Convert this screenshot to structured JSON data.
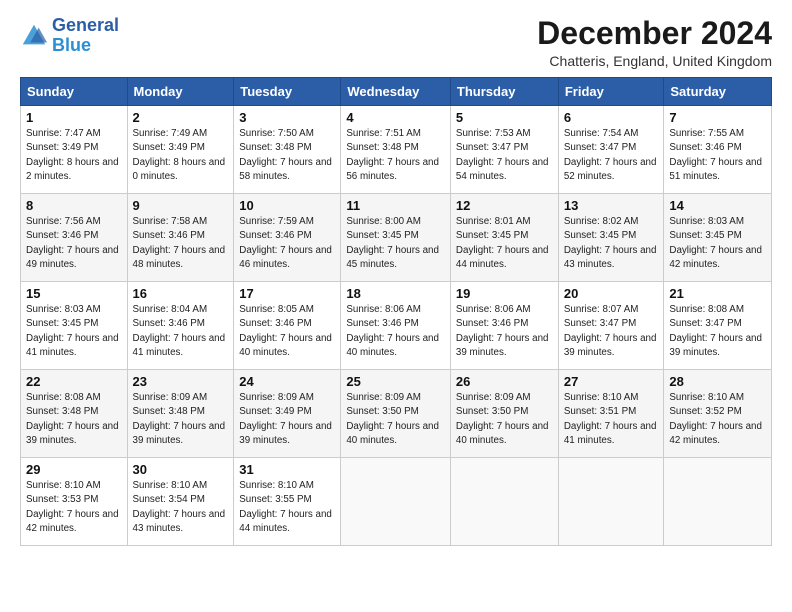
{
  "logo": {
    "line1": "General",
    "line2": "Blue"
  },
  "title": "December 2024",
  "subtitle": "Chatteris, England, United Kingdom",
  "days_header": [
    "Sunday",
    "Monday",
    "Tuesday",
    "Wednesday",
    "Thursday",
    "Friday",
    "Saturday"
  ],
  "weeks": [
    [
      {
        "num": "1",
        "rise": "Sunrise: 7:47 AM",
        "set": "Sunset: 3:49 PM",
        "daylight": "Daylight: 8 hours and 2 minutes."
      },
      {
        "num": "2",
        "rise": "Sunrise: 7:49 AM",
        "set": "Sunset: 3:49 PM",
        "daylight": "Daylight: 8 hours and 0 minutes."
      },
      {
        "num": "3",
        "rise": "Sunrise: 7:50 AM",
        "set": "Sunset: 3:48 PM",
        "daylight": "Daylight: 7 hours and 58 minutes."
      },
      {
        "num": "4",
        "rise": "Sunrise: 7:51 AM",
        "set": "Sunset: 3:48 PM",
        "daylight": "Daylight: 7 hours and 56 minutes."
      },
      {
        "num": "5",
        "rise": "Sunrise: 7:53 AM",
        "set": "Sunset: 3:47 PM",
        "daylight": "Daylight: 7 hours and 54 minutes."
      },
      {
        "num": "6",
        "rise": "Sunrise: 7:54 AM",
        "set": "Sunset: 3:47 PM",
        "daylight": "Daylight: 7 hours and 52 minutes."
      },
      {
        "num": "7",
        "rise": "Sunrise: 7:55 AM",
        "set": "Sunset: 3:46 PM",
        "daylight": "Daylight: 7 hours and 51 minutes."
      }
    ],
    [
      {
        "num": "8",
        "rise": "Sunrise: 7:56 AM",
        "set": "Sunset: 3:46 PM",
        "daylight": "Daylight: 7 hours and 49 minutes."
      },
      {
        "num": "9",
        "rise": "Sunrise: 7:58 AM",
        "set": "Sunset: 3:46 PM",
        "daylight": "Daylight: 7 hours and 48 minutes."
      },
      {
        "num": "10",
        "rise": "Sunrise: 7:59 AM",
        "set": "Sunset: 3:46 PM",
        "daylight": "Daylight: 7 hours and 46 minutes."
      },
      {
        "num": "11",
        "rise": "Sunrise: 8:00 AM",
        "set": "Sunset: 3:45 PM",
        "daylight": "Daylight: 7 hours and 45 minutes."
      },
      {
        "num": "12",
        "rise": "Sunrise: 8:01 AM",
        "set": "Sunset: 3:45 PM",
        "daylight": "Daylight: 7 hours and 44 minutes."
      },
      {
        "num": "13",
        "rise": "Sunrise: 8:02 AM",
        "set": "Sunset: 3:45 PM",
        "daylight": "Daylight: 7 hours and 43 minutes."
      },
      {
        "num": "14",
        "rise": "Sunrise: 8:03 AM",
        "set": "Sunset: 3:45 PM",
        "daylight": "Daylight: 7 hours and 42 minutes."
      }
    ],
    [
      {
        "num": "15",
        "rise": "Sunrise: 8:03 AM",
        "set": "Sunset: 3:45 PM",
        "daylight": "Daylight: 7 hours and 41 minutes."
      },
      {
        "num": "16",
        "rise": "Sunrise: 8:04 AM",
        "set": "Sunset: 3:46 PM",
        "daylight": "Daylight: 7 hours and 41 minutes."
      },
      {
        "num": "17",
        "rise": "Sunrise: 8:05 AM",
        "set": "Sunset: 3:46 PM",
        "daylight": "Daylight: 7 hours and 40 minutes."
      },
      {
        "num": "18",
        "rise": "Sunrise: 8:06 AM",
        "set": "Sunset: 3:46 PM",
        "daylight": "Daylight: 7 hours and 40 minutes."
      },
      {
        "num": "19",
        "rise": "Sunrise: 8:06 AM",
        "set": "Sunset: 3:46 PM",
        "daylight": "Daylight: 7 hours and 39 minutes."
      },
      {
        "num": "20",
        "rise": "Sunrise: 8:07 AM",
        "set": "Sunset: 3:47 PM",
        "daylight": "Daylight: 7 hours and 39 minutes."
      },
      {
        "num": "21",
        "rise": "Sunrise: 8:08 AM",
        "set": "Sunset: 3:47 PM",
        "daylight": "Daylight: 7 hours and 39 minutes."
      }
    ],
    [
      {
        "num": "22",
        "rise": "Sunrise: 8:08 AM",
        "set": "Sunset: 3:48 PM",
        "daylight": "Daylight: 7 hours and 39 minutes."
      },
      {
        "num": "23",
        "rise": "Sunrise: 8:09 AM",
        "set": "Sunset: 3:48 PM",
        "daylight": "Daylight: 7 hours and 39 minutes."
      },
      {
        "num": "24",
        "rise": "Sunrise: 8:09 AM",
        "set": "Sunset: 3:49 PM",
        "daylight": "Daylight: 7 hours and 39 minutes."
      },
      {
        "num": "25",
        "rise": "Sunrise: 8:09 AM",
        "set": "Sunset: 3:50 PM",
        "daylight": "Daylight: 7 hours and 40 minutes."
      },
      {
        "num": "26",
        "rise": "Sunrise: 8:09 AM",
        "set": "Sunset: 3:50 PM",
        "daylight": "Daylight: 7 hours and 40 minutes."
      },
      {
        "num": "27",
        "rise": "Sunrise: 8:10 AM",
        "set": "Sunset: 3:51 PM",
        "daylight": "Daylight: 7 hours and 41 minutes."
      },
      {
        "num": "28",
        "rise": "Sunrise: 8:10 AM",
        "set": "Sunset: 3:52 PM",
        "daylight": "Daylight: 7 hours and 42 minutes."
      }
    ],
    [
      {
        "num": "29",
        "rise": "Sunrise: 8:10 AM",
        "set": "Sunset: 3:53 PM",
        "daylight": "Daylight: 7 hours and 42 minutes."
      },
      {
        "num": "30",
        "rise": "Sunrise: 8:10 AM",
        "set": "Sunset: 3:54 PM",
        "daylight": "Daylight: 7 hours and 43 minutes."
      },
      {
        "num": "31",
        "rise": "Sunrise: 8:10 AM",
        "set": "Sunset: 3:55 PM",
        "daylight": "Daylight: 7 hours and 44 minutes."
      },
      null,
      null,
      null,
      null
    ]
  ]
}
